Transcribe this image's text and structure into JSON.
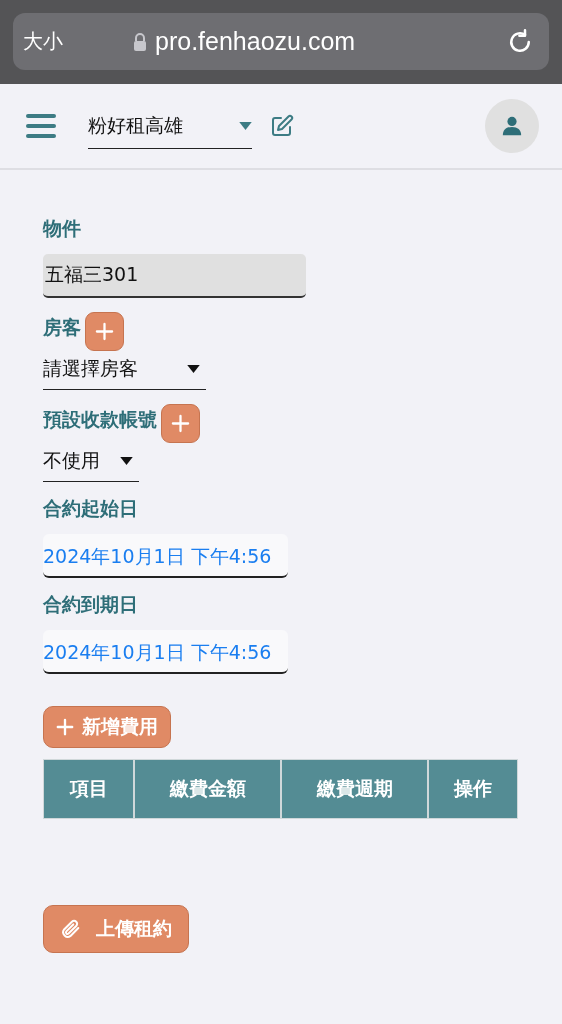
{
  "browser": {
    "text_size": "大小",
    "url": "pro.fenhaozu.com"
  },
  "header": {
    "store": "粉好租高雄"
  },
  "fields": [
    {
      "kind": "readonly",
      "label": "物件",
      "value": "五福三301",
      "add_button": false
    },
    {
      "kind": "select",
      "label": "房客",
      "value": "請選擇房客",
      "add_button": true
    },
    {
      "kind": "select",
      "label": "預設收款帳號",
      "value": "不使用",
      "add_button": true
    },
    {
      "kind": "date",
      "label": "合約起始日",
      "value": "2024年10月1日 下午4:56",
      "add_button": false
    },
    {
      "kind": "date",
      "label": "合約到期日",
      "value": "2024年10月1日 下午4:56",
      "add_button": false
    }
  ],
  "add_fee_button": "新增費用",
  "table": {
    "columns": [
      "項目",
      "繳費金額",
      "繳費週期",
      "操作"
    ]
  },
  "upload_button": "上傳租約"
}
